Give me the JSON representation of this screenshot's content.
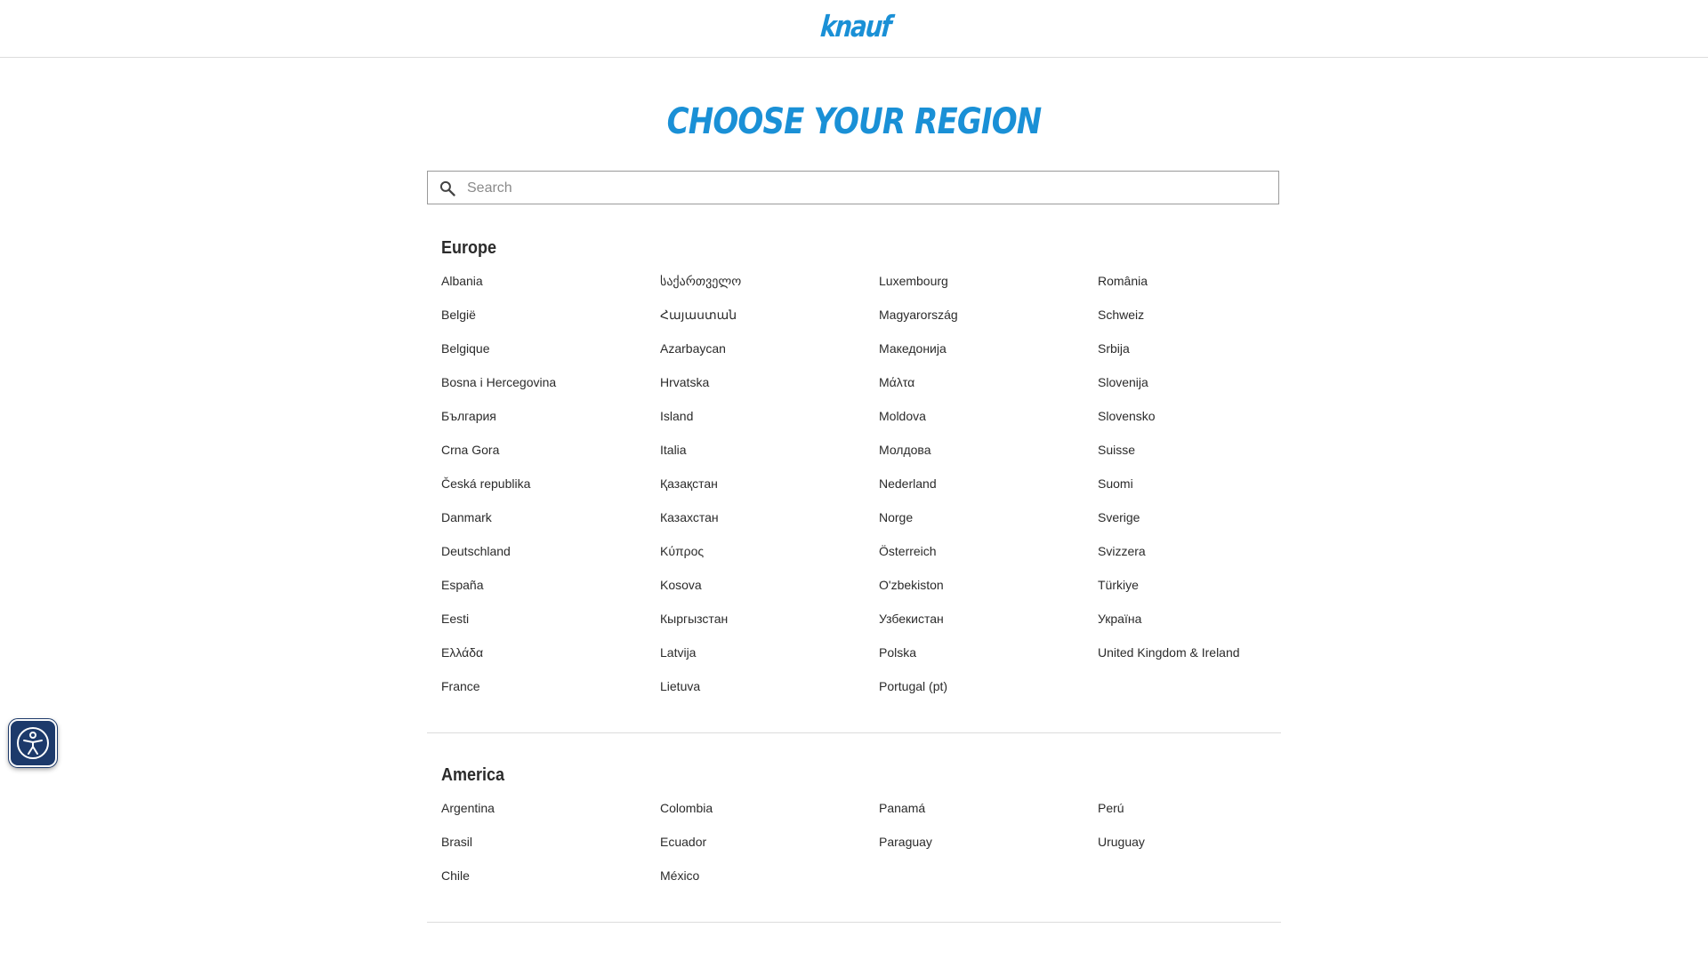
{
  "header": {
    "logo_text": "knauf",
    "brand_color": "#1a90d6"
  },
  "main": {
    "title": "CHOOSE YOUR REGION"
  },
  "search": {
    "placeholder": "Search",
    "value": "",
    "icon": "search-icon"
  },
  "regions": [
    {
      "name": "Europe",
      "countries": [
        "Albania",
        "België",
        "Belgique",
        "Bosna i Hercegovina",
        "България",
        "Crna Gora",
        "Česká republika",
        "Danmark",
        "Deutschland",
        "España",
        "Eesti",
        "Ελλάδα",
        "France",
        "საქართველო",
        "Հայաստան",
        "Azarbaycan",
        "Hrvatska",
        "Island",
        "Italia",
        "Қазақстан",
        "Казахстан",
        "Κύπρος",
        "Kosova",
        "Кыргызстан",
        "Latvija",
        "Lietuva",
        "Luxembourg",
        "Magyarország",
        "Македонија",
        "Μάλτα",
        "Moldova",
        "Молдова",
        "Nederland",
        "Norge",
        "Österreich",
        "O'zbekiston",
        "Узбекистан",
        "Polska",
        "Portugal (pt)",
        "România",
        "Schweiz",
        "Srbija",
        "Slovenija",
        "Slovensko",
        "Suisse",
        "Suomi",
        "Sverige",
        "Svizzera",
        "Türkiye",
        "Україна",
        "United Kingdom & Ireland"
      ]
    },
    {
      "name": "America",
      "countries": [
        "Argentina",
        "Brasil",
        "Chile",
        "Colombia",
        "Ecuador",
        "México",
        "Panamá",
        "Paraguay",
        "Perú",
        "Uruguay"
      ]
    }
  ],
  "accessibility": {
    "icon": "accessibility-icon",
    "color": "#1d3a6b"
  }
}
